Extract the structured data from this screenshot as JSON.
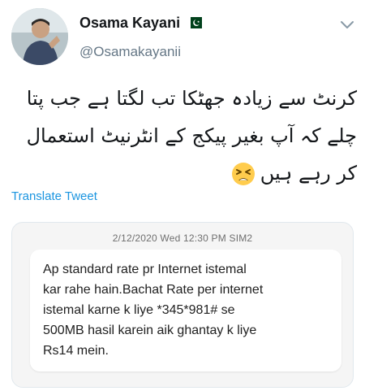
{
  "author": {
    "display_name": "Osama Kayani",
    "handle": "@Osamakayanii",
    "flag_icon": "pakistan-flag-icon"
  },
  "menu_icon": "chevron-down-icon",
  "tweet": {
    "lines": [
      "کرنٹ سے زیادہ جھٹکا تب لگتا ہے جب پتا",
      "چلے کہ آپ بغیر پیکج کے انٹرنیٹ استعمال",
      "کر رہے ہیں"
    ],
    "emoji_icon": "tired-face-emoji-icon"
  },
  "translate_label": "Translate Tweet",
  "media": {
    "sms_header": "2/12/2020 Wed 12:30 PM  SIM2",
    "sms_lines": [
      "Ap standard rate pr Internet istemal",
      "kar rahe hain.Bachat Rate per internet",
      "istemal karne k liye *345*981# se",
      "500MB hasil karein aik ghantay k liye",
      "Rs14 mein."
    ]
  },
  "colors": {
    "link": "#1b95e0",
    "secondary_text": "#657786",
    "primary_text": "#14171a"
  }
}
